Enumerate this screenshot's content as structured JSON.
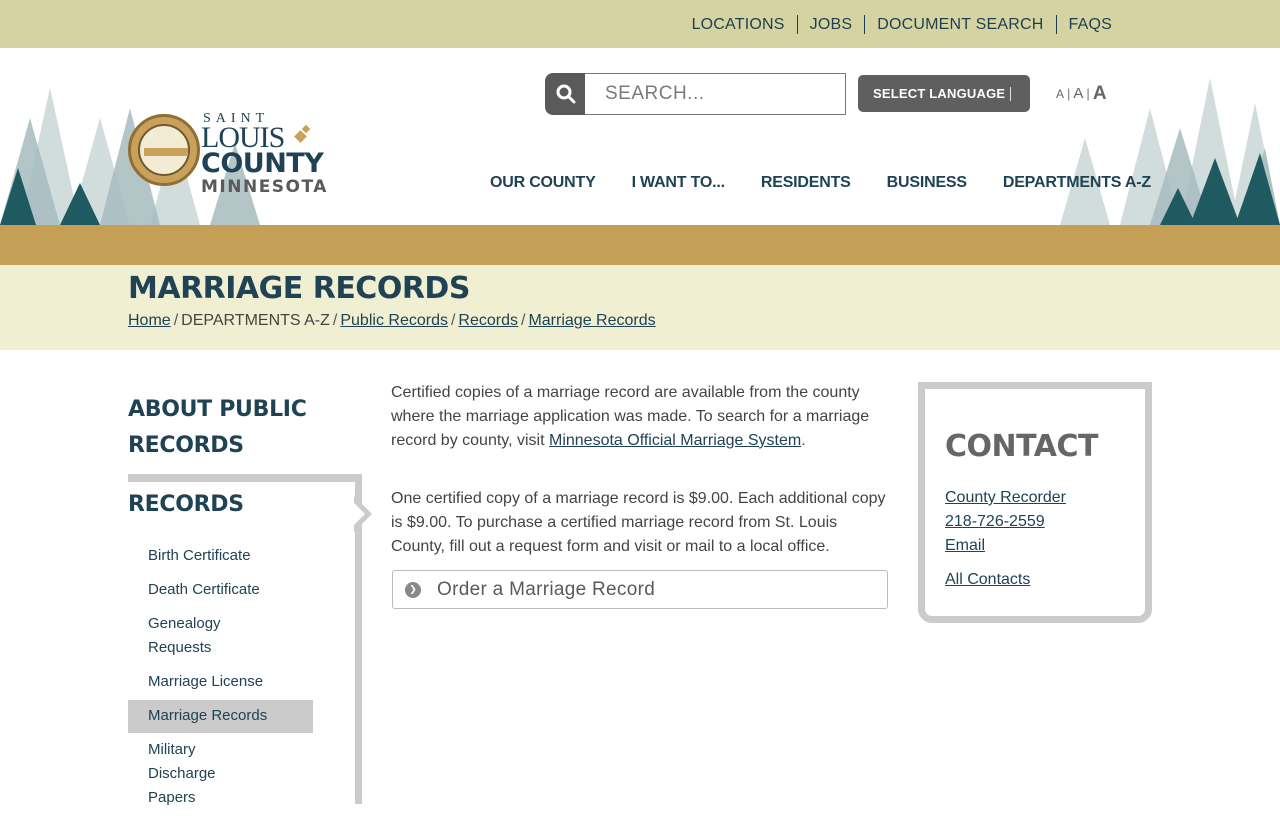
{
  "utility_nav": [
    "LOCATIONS",
    "JOBS",
    "DOCUMENT SEARCH",
    "FAQS"
  ],
  "logo": {
    "line1": "SAINT",
    "line2": "LOUIS",
    "line3": "COUNTY",
    "line4": "MINNESOTA"
  },
  "search": {
    "placeholder": "SEARCH..."
  },
  "language": {
    "label": "SELECT LANGUAGE"
  },
  "font_size": {
    "small": "A",
    "medium": "A",
    "large": "A",
    "separator": "|"
  },
  "main_nav": [
    "OUR COUNTY",
    "I WANT TO...",
    "RESIDENTS",
    "BUSINESS",
    "DEPARTMENTS A-Z"
  ],
  "page": {
    "title": "MARRIAGE RECORDS",
    "breadcrumb": {
      "home": "Home",
      "departments": "DEPARTMENTS A-Z",
      "public_records": "Public Records",
      "records": "Records",
      "current": "Marriage Records",
      "separator": "/"
    }
  },
  "sidebar": {
    "heading_1": "ABOUT PUBLIC RECORDS",
    "heading_2": "RECORDS",
    "items": [
      {
        "label": "Birth Certificate",
        "active": false
      },
      {
        "label": "Death Certificate",
        "active": false
      },
      {
        "label": "Genealogy Requests",
        "active": false
      },
      {
        "label": "Marriage License",
        "active": false
      },
      {
        "label": "Marriage Records",
        "active": true
      },
      {
        "label": "Military Discharge Papers",
        "active": false
      }
    ]
  },
  "content": {
    "para1_before": "Certified copies of a marriage record are available from the county where the marriage application was made. To search for a marriage record by county, visit ",
    "para1_link": "Minnesota Official Marriage System",
    "para1_after": ".",
    "para2": "One certified copy of a marriage record is $9.00. Each additional copy is $9.00. To purchase a certified marriage record from St. Louis County, fill out a request form and visit or mail to a local office.",
    "accordion_label": "Order a Marriage Record"
  },
  "contact": {
    "title": "CONTACT",
    "department": "County Recorder",
    "phone": "218-726-2559",
    "email": "Email",
    "all_contacts": "All Contacts"
  },
  "colors": {
    "utility_bar": "#d6d3a3",
    "gold_band": "#c59f55",
    "title_band": "#f0efd1",
    "brand_dark": "#1f4254",
    "sidebar_gray": "#cbcbcb"
  }
}
